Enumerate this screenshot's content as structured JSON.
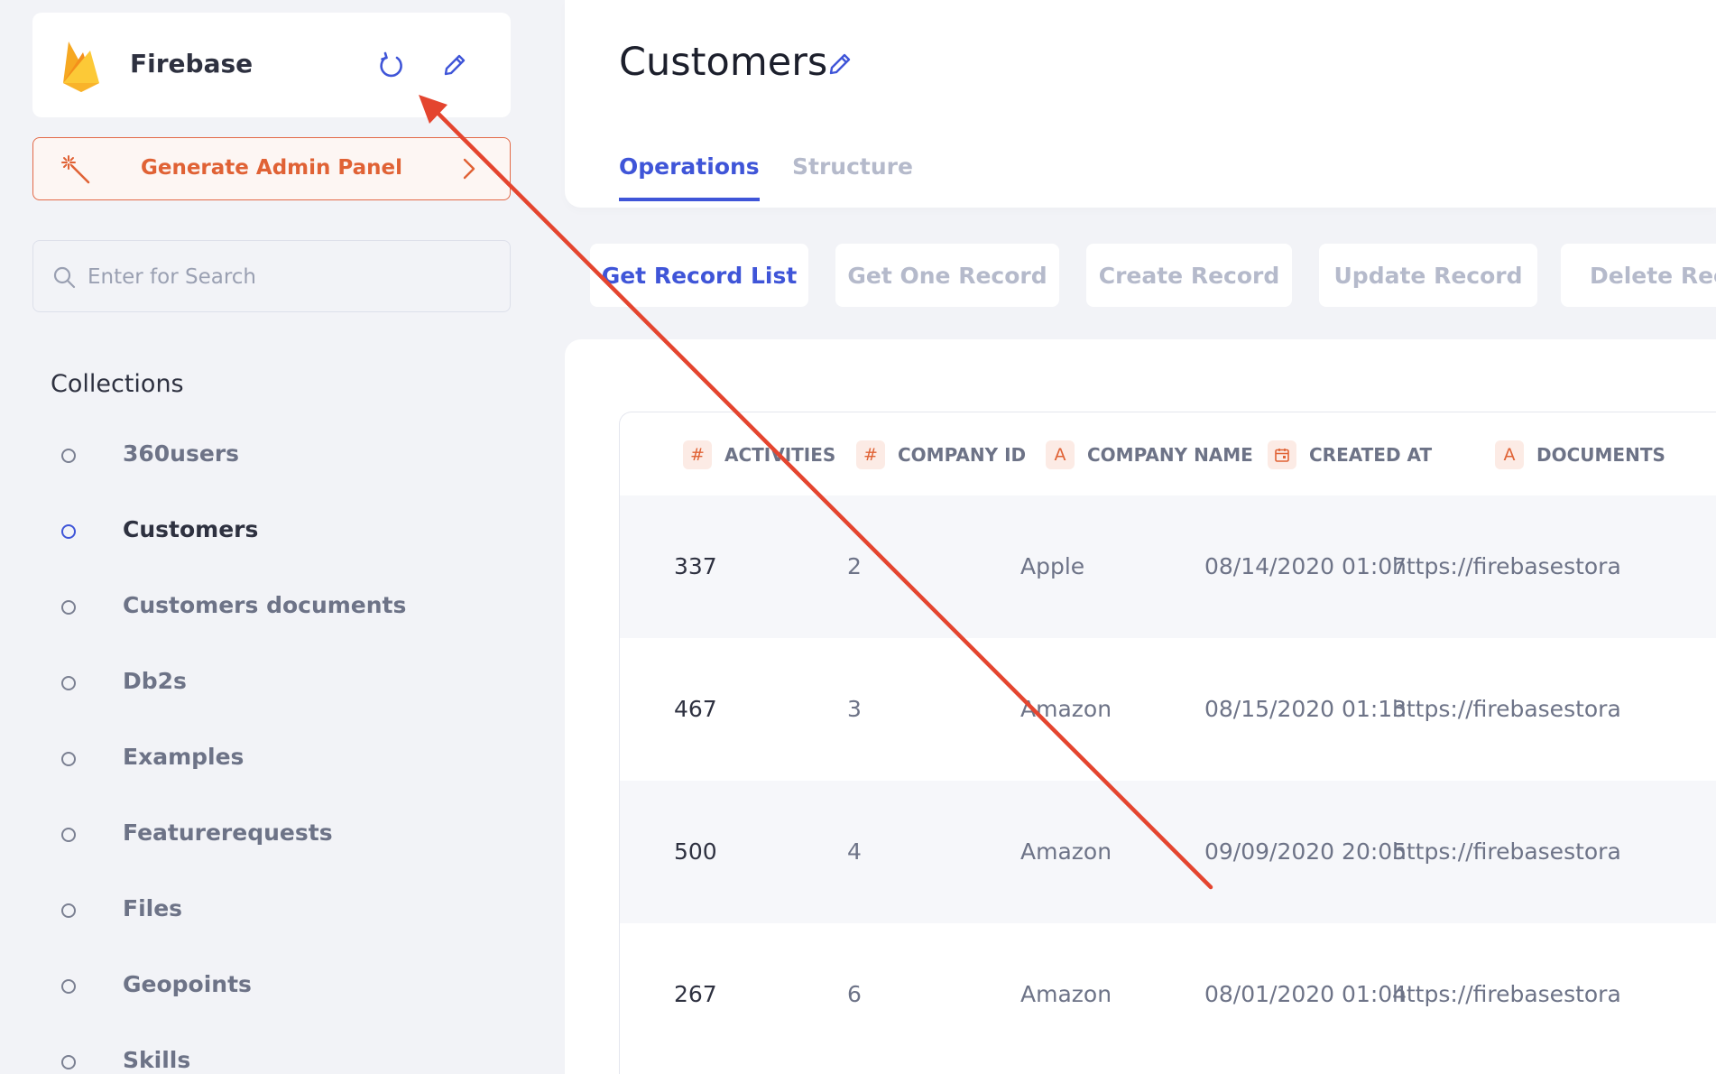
{
  "sidebar": {
    "connection_name": "Firebase",
    "generate_label": "Generate Admin Panel",
    "search_placeholder": "Enter for Search",
    "collections_title": "Collections",
    "collections": [
      {
        "label": "360users",
        "active": false
      },
      {
        "label": "Customers",
        "active": true
      },
      {
        "label": "Customers documents",
        "active": false
      },
      {
        "label": "Db2s",
        "active": false
      },
      {
        "label": "Examples",
        "active": false
      },
      {
        "label": "Featurerequests",
        "active": false
      },
      {
        "label": "Files",
        "active": false
      },
      {
        "label": "Geopoints",
        "active": false
      },
      {
        "label": "Skills",
        "active": false
      }
    ]
  },
  "header": {
    "title": "Customers",
    "tabs": [
      "Operations",
      "Structure"
    ]
  },
  "operations": [
    "Get Record List",
    "Get One Record",
    "Create Record",
    "Update Record",
    "Delete Reco"
  ],
  "table": {
    "columns": [
      {
        "type_icon": "#",
        "label": "ACTIVITIES"
      },
      {
        "type_icon": "#",
        "label": "COMPANY ID"
      },
      {
        "type_icon": "A",
        "label": "COMPANY NAME"
      },
      {
        "type_icon": "calendar",
        "label": "CREATED AT"
      },
      {
        "type_icon": "A",
        "label": "DOCUMENTS"
      }
    ],
    "rows": [
      [
        "337",
        "2",
        "Apple",
        "08/14/2020 01:07",
        "https://firebasestora"
      ],
      [
        "467",
        "3",
        "Amazon",
        "08/15/2020 01:13",
        "https://firebasestora"
      ],
      [
        "500",
        "4",
        "Amazon",
        "09/09/2020 20:05",
        "https://firebasestora"
      ],
      [
        "267",
        "6",
        "Amazon",
        "08/01/2020 01:04",
        "https://firebasestora"
      ]
    ]
  },
  "colors": {
    "accent": "#3f55d8",
    "generate": "#e06235",
    "annotation_arrow": "#e4452f"
  }
}
